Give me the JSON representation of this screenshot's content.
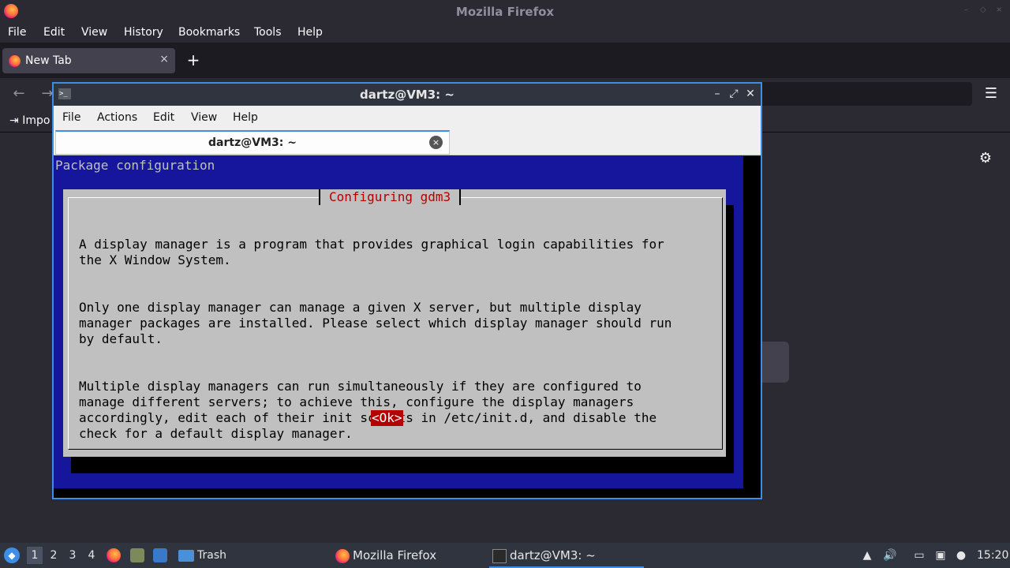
{
  "firefox": {
    "window_title": "Mozilla Firefox",
    "menu": [
      "File",
      "Edit",
      "View",
      "History",
      "Bookmarks",
      "Tools",
      "Help"
    ],
    "tab": {
      "label": "New Tab",
      "close": "×"
    },
    "new_tab": "+",
    "bookmarks": {
      "import_label": "Impo"
    },
    "controls": {
      "minimize": "–",
      "restore": "◇",
      "close": "×"
    }
  },
  "terminal": {
    "window_title": "dartz@VM3: ~",
    "menu": [
      "File",
      "Actions",
      "Edit",
      "View",
      "Help"
    ],
    "tab_title": "dartz@VM3: ~",
    "tab_close": "×",
    "screen": {
      "header": "Package configuration",
      "dialog_title": "Configuring gdm3",
      "paragraphs": [
        "A display manager is a program that provides graphical login capabilities for\nthe X Window System.",
        "Only one display manager can manage a given X server, but multiple display\nmanager packages are installed. Please select which display manager should run\nby default.",
        "Multiple display managers can run simultaneously if they are configured to\nmanage different servers; to achieve this, configure the display managers\naccordingly, edit each of their init scripts in /etc/init.d, and disable the\ncheck for a default display manager."
      ],
      "ok_button": "<Ok>"
    }
  },
  "taskbar": {
    "workspaces": [
      "1",
      "2",
      "3",
      "4"
    ],
    "active_workspace": "1",
    "trash_label": "Trash",
    "tasks": [
      "Mozilla Firefox",
      "dartz@VM3: ~"
    ],
    "clock": "15:20"
  },
  "colors": {
    "accent": "#3d8ee6",
    "terminal_blue": "#16169c",
    "dialog_gray": "#c0c0c0",
    "dialog_red": "#b50000"
  }
}
